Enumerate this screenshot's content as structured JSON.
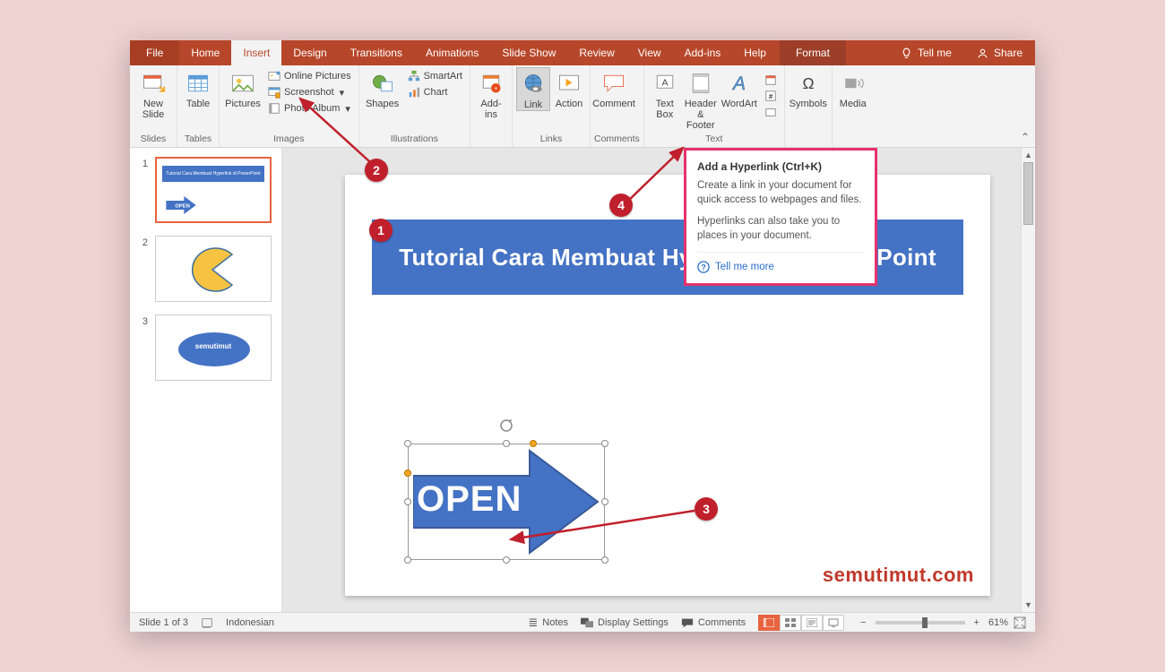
{
  "tabs": {
    "file": "File",
    "home": "Home",
    "insert": "Insert",
    "design": "Design",
    "transitions": "Transitions",
    "animations": "Animations",
    "slideshow": "Slide Show",
    "review": "Review",
    "view": "View",
    "addins": "Add-ins",
    "help": "Help",
    "format": "Format"
  },
  "titlebar": {
    "tell": "Tell me",
    "share": "Share"
  },
  "ribbon": {
    "slides": {
      "new_slide": "New\nSlide",
      "group": "Slides"
    },
    "tables": {
      "table": "Table",
      "group": "Tables"
    },
    "images": {
      "pictures": "Pictures",
      "online_pictures": "Online Pictures",
      "screenshot": "Screenshot",
      "photo_album": "Photo Album",
      "group": "Images"
    },
    "illus": {
      "shapes": "Shapes",
      "smartart": "SmartArt",
      "chart": "Chart",
      "group": "Illustrations"
    },
    "addins": {
      "addins": "Add-\nins",
      "group": ""
    },
    "links": {
      "link": "Link",
      "action": "Action",
      "group": "Links"
    },
    "comments": {
      "comment": "Comment",
      "group": "Comments"
    },
    "text": {
      "textbox": "Text\nBox",
      "header": "Header\n& Footer",
      "wordart": "WordArt",
      "group": "Text"
    },
    "symbols": {
      "symbols": "Symbols",
      "group": ""
    },
    "media": {
      "media": "Media",
      "group": ""
    }
  },
  "tooltip": {
    "title": "Add a Hyperlink (Ctrl+K)",
    "p1": "Create a link in your document for quick access to webpages and files.",
    "p2": "Hyperlinks can also take you to places in your document.",
    "more": "Tell me more"
  },
  "slide": {
    "title_text": "Tutorial Cara Membuat Hyperlink di PowerPoint",
    "arrow_text": "OPEN",
    "thumb1_title": "Tutorial Cara Membuat Hyperlink di PowerPoint",
    "thumb1_arrow": "OPEN",
    "thumb3_text": "semutimut"
  },
  "watermark": "semutimut.com",
  "status": {
    "slide_info": "Slide 1 of 3",
    "lang": "Indonesian",
    "notes": "Notes",
    "display": "Display Settings",
    "comments": "Comments",
    "zoom_pct": "61%",
    "minus": "−",
    "plus": "+"
  },
  "callouts": {
    "c1": "1",
    "c2": "2",
    "c3": "3",
    "c4": "4"
  },
  "thumb_nums": {
    "n1": "1",
    "n2": "2",
    "n3": "3"
  }
}
